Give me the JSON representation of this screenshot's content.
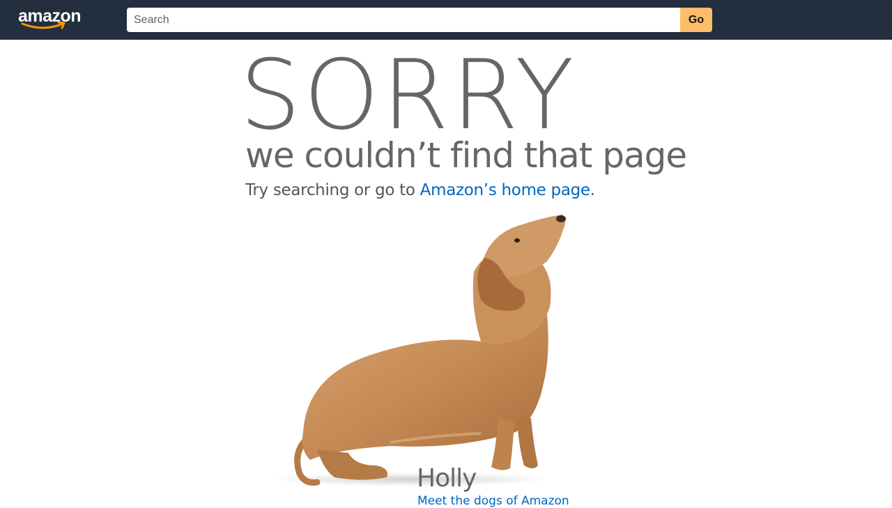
{
  "header": {
    "logo_text": "amazon",
    "search": {
      "placeholder": "Search",
      "value": ""
    },
    "go_label": "Go"
  },
  "error": {
    "headline": "SORRY",
    "subhead": "we couldn’t find that page",
    "try_prefix": "Try searching or go to ",
    "home_link": "Amazon’s home page",
    "try_suffix": "."
  },
  "dog": {
    "name": "Holly",
    "link": "Meet the dogs of Amazon"
  },
  "colors": {
    "header_bg": "#232f3e",
    "go_button": "#febd69",
    "link": "#0066c0",
    "smile": "#ff9900"
  }
}
